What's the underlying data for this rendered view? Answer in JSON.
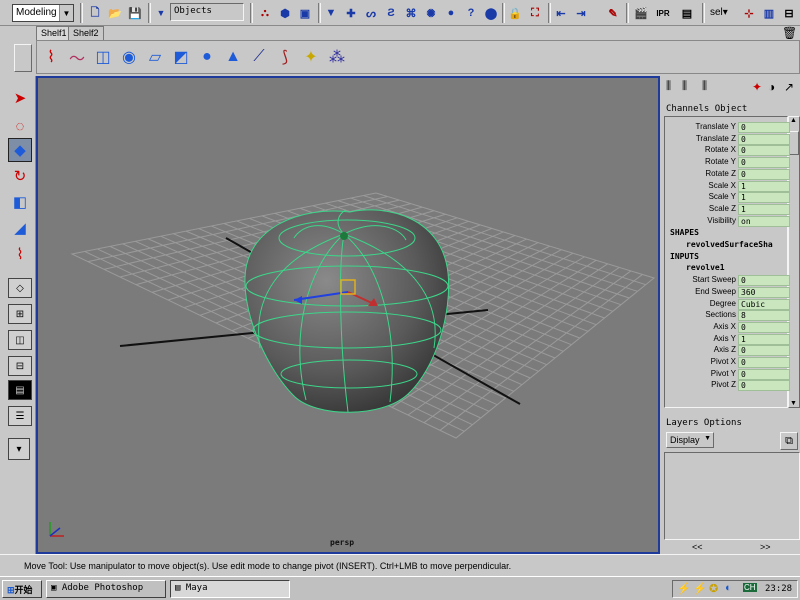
{
  "statusline": {
    "menu_set": "Modeling",
    "selection_field": "Objects",
    "sel_label": "sel"
  },
  "shelf": {
    "tabs": [
      "Shelf1",
      "Shelf2"
    ],
    "icons": [
      "curve-icon",
      "nurbs-curve-icon",
      "cylinder-icon",
      "revolve-icon",
      "extrude-icon",
      "plane-icon",
      "sphere-icon",
      "cone-icon",
      "joint-icon",
      "ik-handle-icon",
      "spotlight-icon",
      "particle-icon"
    ]
  },
  "toolbox": {
    "tools": [
      "select-tool-icon",
      "lasso-tool-icon",
      "move-tool-icon",
      "rotate-tool-icon",
      "scale-tool-icon",
      "universal-manip-icon",
      "soft-mod-icon"
    ]
  },
  "viewport": {
    "camera_label": "persp"
  },
  "channel_box": {
    "menu": "Channels Object",
    "transform": [
      {
        "label": "Translate Y",
        "value": "0"
      },
      {
        "label": "Translate Z",
        "value": "0"
      },
      {
        "label": "Rotate X",
        "value": "0"
      },
      {
        "label": "Rotate Y",
        "value": "0"
      },
      {
        "label": "Rotate Z",
        "value": "0"
      },
      {
        "label": "Scale X",
        "value": "1"
      },
      {
        "label": "Scale Y",
        "value": "1"
      },
      {
        "label": "Scale Z",
        "value": "1"
      },
      {
        "label": "Visibility",
        "value": "on"
      }
    ],
    "shapes_header": "SHAPES",
    "shape_name": "revolvedSurfaceSha",
    "inputs_header": "INPUTS",
    "input_name": "revolve1",
    "inputs": [
      {
        "label": "Start Sweep",
        "value": "0"
      },
      {
        "label": "End Sweep",
        "value": "360"
      },
      {
        "label": "Degree",
        "value": "Cubic"
      },
      {
        "label": "Sections",
        "value": "8"
      },
      {
        "label": "Axis X",
        "value": "0"
      },
      {
        "label": "Axis Y",
        "value": "1"
      },
      {
        "label": "Axis Z",
        "value": "0"
      },
      {
        "label": "Pivot X",
        "value": "0"
      },
      {
        "label": "Pivot Y",
        "value": "0"
      },
      {
        "label": "Pivot Z",
        "value": "0"
      }
    ]
  },
  "layer_editor": {
    "menu": "Layers  Options",
    "display": "Display",
    "prev": "<<",
    "next": ">>"
  },
  "help_line": "Move Tool: Use manipulator to move object(s). Use edit mode to change pivot (INSERT).  Ctrl+LMB to move perpendicular.",
  "taskbar": {
    "start": "开始",
    "tasks": [
      "Adobe Photoshop",
      "Maya"
    ],
    "tray_text": "CH",
    "clock": "23:28"
  }
}
